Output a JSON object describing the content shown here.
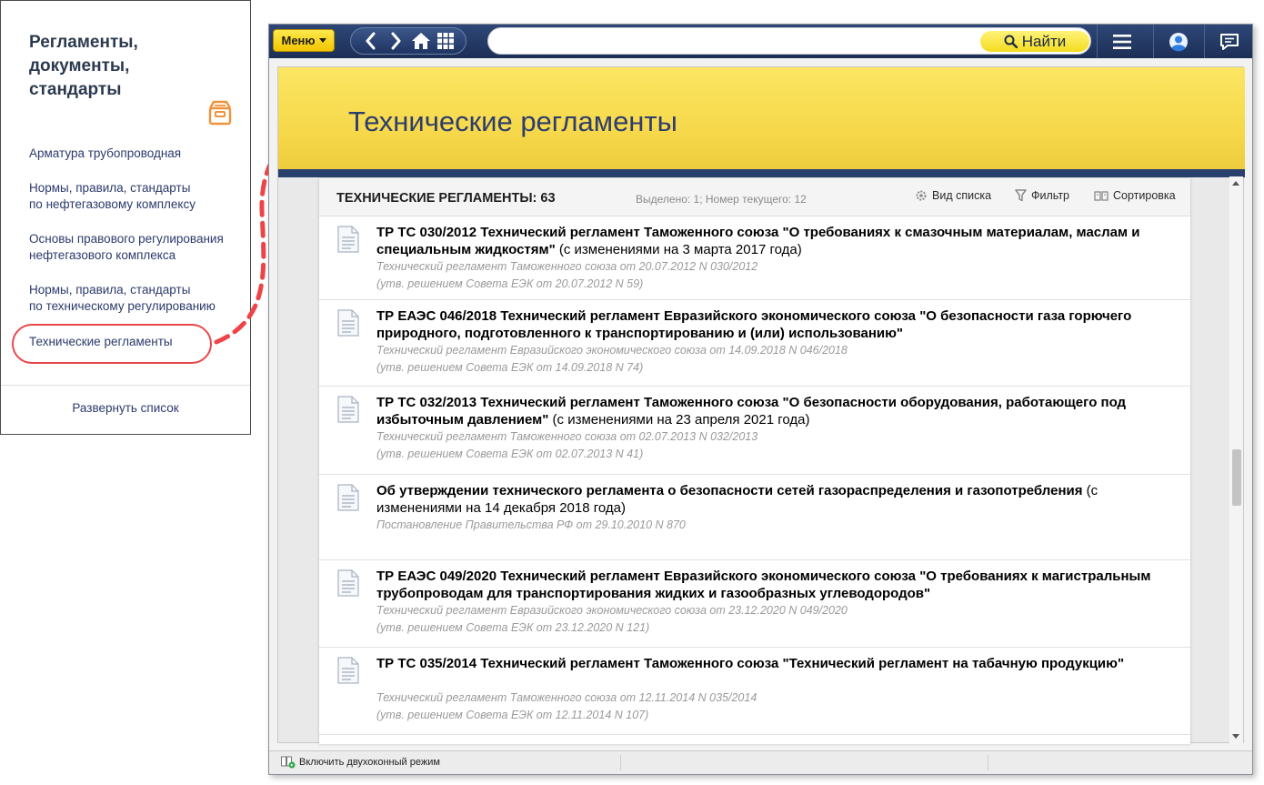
{
  "left_panel": {
    "title": "Регламенты, документы, стандарты",
    "items": [
      {
        "label": "Арматура трубопроводная"
      },
      {
        "label": "Нормы, правила, стандарты\nпо нефтегазовому комплексу"
      },
      {
        "label": "Основы правового регулирования\nнефтегазового комплекса"
      },
      {
        "label": "Нормы, правила, стандарты\nпо техническому регулированию"
      },
      {
        "label": "Технические регламенты"
      }
    ],
    "expand_label": "Развернуть список"
  },
  "toolbar": {
    "menu_label": "Меню",
    "search_button": "Найти",
    "search_value": ""
  },
  "banner": {
    "title": "Технические регламенты"
  },
  "list": {
    "header_title": "ТЕХНИЧЕСКИЕ РЕГЛАМЕНТЫ: 63",
    "header_meta": "Выделено: 1; Номер текущего: 12",
    "tools": {
      "view": "Вид списка",
      "filter": "Фильтр",
      "sort": "Сортировка"
    },
    "docs": [
      {
        "title": "ТР ТС 030/2012 Технический регламент Таможенного союза \"О требованиях к смазочным материалам, маслам и специальным жидкостям\"",
        "changes": " (с изменениями на 3 марта 2017 года)",
        "lines": [
          "Технический регламент Таможенного союза от 20.07.2012 N 030/2012",
          "(утв. решением Совета ЕЭК от 20.07.2012 N 59)"
        ]
      },
      {
        "title": "ТР ЕАЭС 046/2018 Технический регламент Евразийского экономического союза \"О безопасности газа горючего природного, подготовленного к транспортированию и (или) использованию\"",
        "changes": "",
        "lines": [
          "Технический регламент Евразийского экономического союза от 14.09.2018 N 046/2018",
          "(утв. решением Совета ЕЭК от 14.09.2018 N 74)"
        ]
      },
      {
        "title": "ТР ТС 032/2013 Технический регламент Таможенного союза \"О безопасности оборудования, работающего под избыточным давлением\"",
        "changes": " (с изменениями на 23 апреля 2021 года)",
        "lines": [
          "Технический регламент Таможенного союза от 02.07.2013 N 032/2013",
          "(утв. решением Совета ЕЭК от 02.07.2013 N 41)"
        ]
      },
      {
        "title": "Об утверждении технического регламента о безопасности сетей газораспределения и газопотребления",
        "changes": " (с изменениями на 14 декабря 2018 года)",
        "lines": [
          "Постановление Правительства РФ от 29.10.2010 N 870"
        ]
      },
      {
        "title": "ТР ЕАЭС 049/2020 Технический регламент Евразийского экономического союза \"О требованиях к магистральным трубопроводам для транспортирования жидких и газообразных углеводородов\"",
        "changes": "",
        "lines": [
          "Технический регламент Евразийского экономического союза от 23.12.2020 N 049/2020",
          "(утв. решением Совета ЕЭК от 23.12.2020 N 121)"
        ]
      },
      {
        "title": "ТР ТС 035/2014 Технический регламент Таможенного союза \"Технический регламент на табачную продукцию\"",
        "changes": "",
        "lines": [
          "Технический регламент Таможенного союза от 12.11.2014 N 035/2014",
          "(утв. решением Совета ЕЭК от 12.11.2014 N 107)"
        ]
      }
    ]
  },
  "statusbar": {
    "dual_window": "Включить двухоконный режим"
  },
  "colors": {
    "accent_yellow": "#f6d84a",
    "toolbar_navy": "#1c2f56",
    "highlight_red": "#e8474c"
  }
}
